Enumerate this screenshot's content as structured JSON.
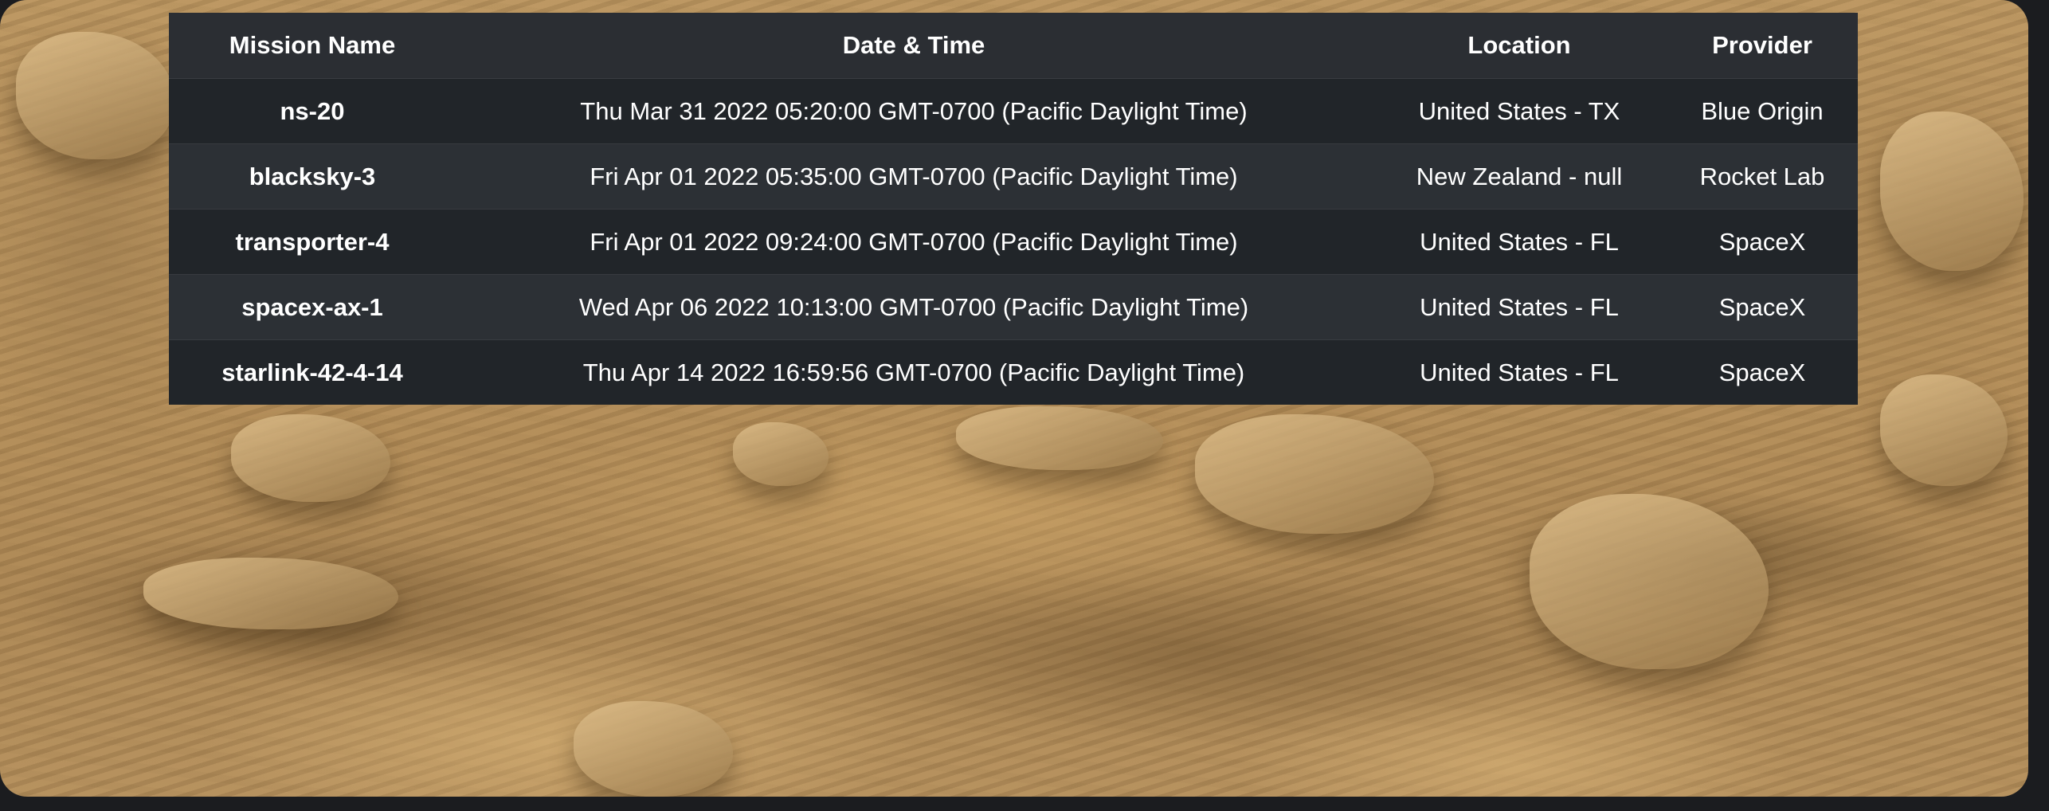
{
  "table": {
    "headers": [
      "Mission Name",
      "Date & Time",
      "Location",
      "Provider"
    ],
    "rows": [
      {
        "mission": "ns-20",
        "datetime": "Thu Mar 31 2022 05:20:00 GMT-0700 (Pacific Daylight Time)",
        "location": "United States - TX",
        "provider": "Blue Origin"
      },
      {
        "mission": "blacksky-3",
        "datetime": "Fri Apr 01 2022 05:35:00 GMT-0700 (Pacific Daylight Time)",
        "location": "New Zealand - null",
        "provider": "Rocket Lab"
      },
      {
        "mission": "transporter-4",
        "datetime": "Fri Apr 01 2022 09:24:00 GMT-0700 (Pacific Daylight Time)",
        "location": "United States - FL",
        "provider": "SpaceX"
      },
      {
        "mission": "spacex-ax-1",
        "datetime": "Wed Apr 06 2022 10:13:00 GMT-0700 (Pacific Daylight Time)",
        "location": "United States - FL",
        "provider": "SpaceX"
      },
      {
        "mission": "starlink-42-4-14",
        "datetime": "Thu Apr 14 2022 16:59:56 GMT-0700 (Pacific Daylight Time)",
        "location": "United States - FL",
        "provider": "SpaceX"
      }
    ]
  },
  "background": {
    "description_icon": "mars-rock-landscape-image",
    "colors": {
      "sand": "#b38d58",
      "table_dark": "#212529",
      "table_light": "#2c3035",
      "header": "#2b2e33"
    }
  }
}
